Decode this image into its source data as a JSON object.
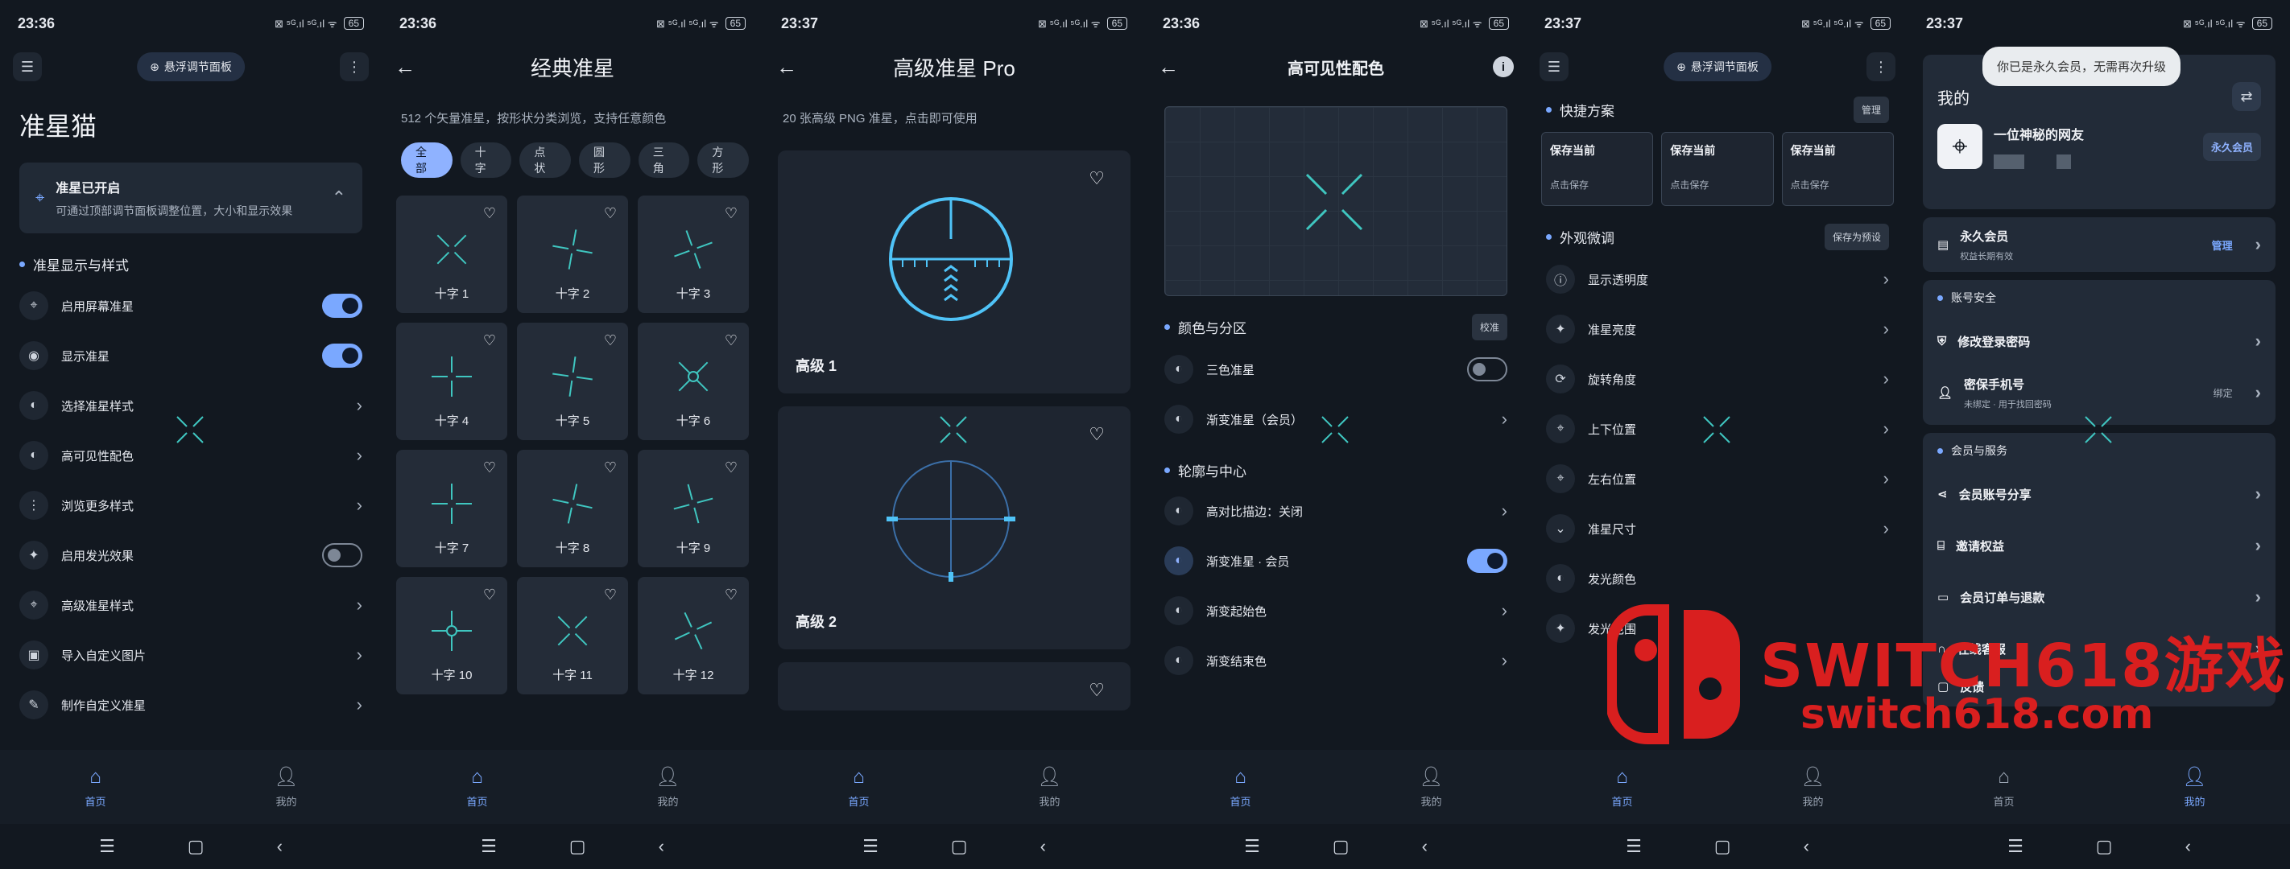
{
  "screens": [
    {
      "time": "23:36",
      "status_icons": "⊠ ⁵ᴳ.ıl ⁵ᴳ.ıl ᯤ",
      "battery": "65",
      "float_button": "悬浮调节面板",
      "title": "准星猫",
      "banner_title": "准星已开启",
      "banner_desc": "可通过顶部调节面板调整位置，大小和显示效果",
      "section": "准星显示与样式",
      "items": [
        "启用屏幕准星",
        "显示准星",
        "选择准星样式",
        "高可见性配色",
        "浏览更多样式",
        "启用发光效果",
        "高级准星样式",
        "导入自定义图片",
        "制作自定义准星"
      ]
    },
    {
      "time": "23:36",
      "title": "经典准星",
      "subtitle": "512 个矢量准星，按形状分类浏览，支持任意颜色",
      "chips": [
        "全部",
        "十字",
        "点状",
        "圆形",
        "三角",
        "方形"
      ],
      "tiles": [
        "十字 1",
        "十字 2",
        "十字 3",
        "十字 4",
        "十字 5",
        "十字 6",
        "十字 7",
        "十字 8",
        "十字 9",
        "十字 10",
        "十字 11",
        "十字 12"
      ]
    },
    {
      "time": "23:37",
      "title": "高级准星 Pro",
      "subtitle": "20 张高级 PNG 准星，点击即可使用",
      "cards": [
        "高级 1",
        "高级 2"
      ]
    },
    {
      "time": "23:36",
      "title": "高可见性配色",
      "section1": "颜色与分区",
      "section1_btn": "校准",
      "items1": [
        "三色准星",
        "渐变准星（会员）"
      ],
      "section2": "轮廓与中心",
      "items2": [
        "高对比描边：关闭",
        "渐变准星 · 会员",
        "渐变起始色",
        "渐变结束色"
      ]
    },
    {
      "time": "23:37",
      "float_button": "悬浮调节面板",
      "section1": "快捷方案",
      "section1_btn": "管理",
      "save_title": "保存当前",
      "save_sub": "点击保存",
      "section2": "外观微调",
      "section2_btn": "保存为预设",
      "items": [
        "显示透明度",
        "准星亮度",
        "旋转角度",
        "上下位置",
        "左右位置",
        "准星尺寸",
        "发光颜色",
        "发光范围"
      ]
    },
    {
      "time": "23:37",
      "toast": "你已是永久会员，无需再次升级",
      "header": "我的",
      "username": "一位神秘的网友",
      "badge": "永久会员",
      "membership_title": "永久会员",
      "membership_sub": "权益长期有效",
      "membership_action": "管理",
      "section_security": "账号安全",
      "security_items": [
        {
          "label": "修改登录密码",
          "sub": "",
          "action": ""
        },
        {
          "label": "密保手机号",
          "sub": "未绑定 · 用于找回密码",
          "action": "绑定"
        }
      ],
      "section_services": "会员与服务",
      "service_items": [
        "会员账号分享",
        "邀请权益",
        "会员订单与退款",
        "在线客服",
        "反馈"
      ]
    }
  ],
  "nav": {
    "home": "首页",
    "mine": "我的"
  },
  "watermark": {
    "big": "SWITCH618游戏",
    "small": "switch618.com"
  },
  "colors": {
    "accent": "#7aa8ff",
    "crosshair": "#3fc6c0",
    "watermark": "#d91f1f"
  }
}
